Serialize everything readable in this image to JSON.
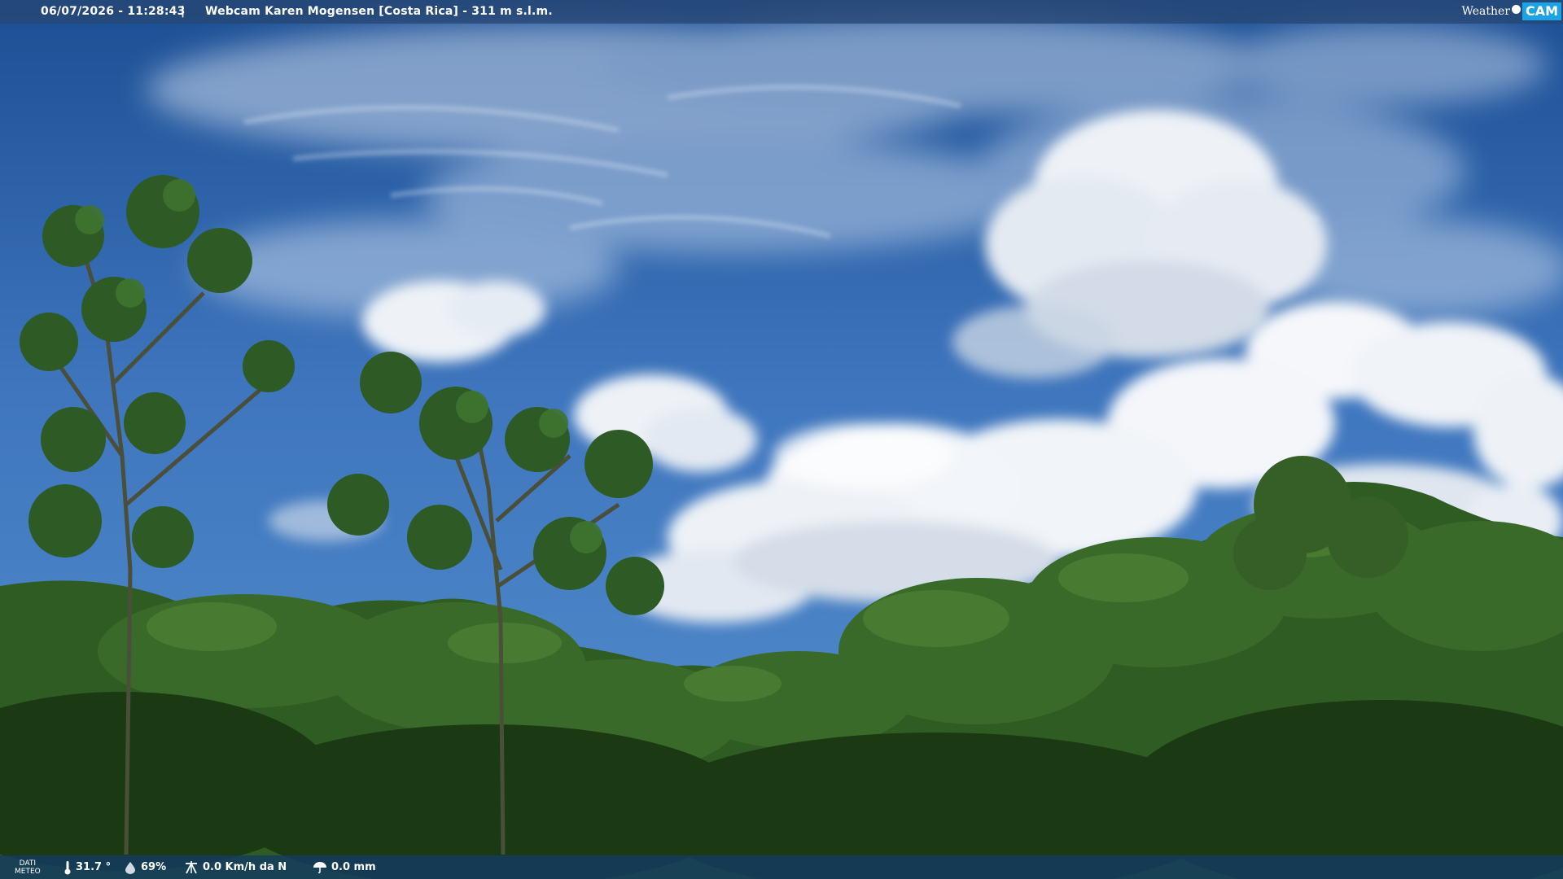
{
  "header": {
    "timestamp": "06/07/2026 - 11:28:43",
    "separator": "|",
    "title": "Webcam Karen Mogensen [Costa Rica]  - 311 m s.l.m."
  },
  "logo": {
    "weather": "Weather",
    "cam": "CAM"
  },
  "meteo": {
    "label_line1": "DATI",
    "label_line2": "METEO",
    "temperature": "31.7 °",
    "humidity": "69%",
    "wind": "0.0 Km/h da N",
    "rain": "0.0 mm"
  },
  "colors": {
    "sky_top": "#1c4f94",
    "sky_mid": "#3f76be",
    "cloud": "#f2f5f9",
    "foliage_dark": "#1b3a14",
    "foliage_mid": "#2f5c22",
    "foliage_light": "#4c7d34",
    "accent_cam": "#1ba3e6"
  }
}
